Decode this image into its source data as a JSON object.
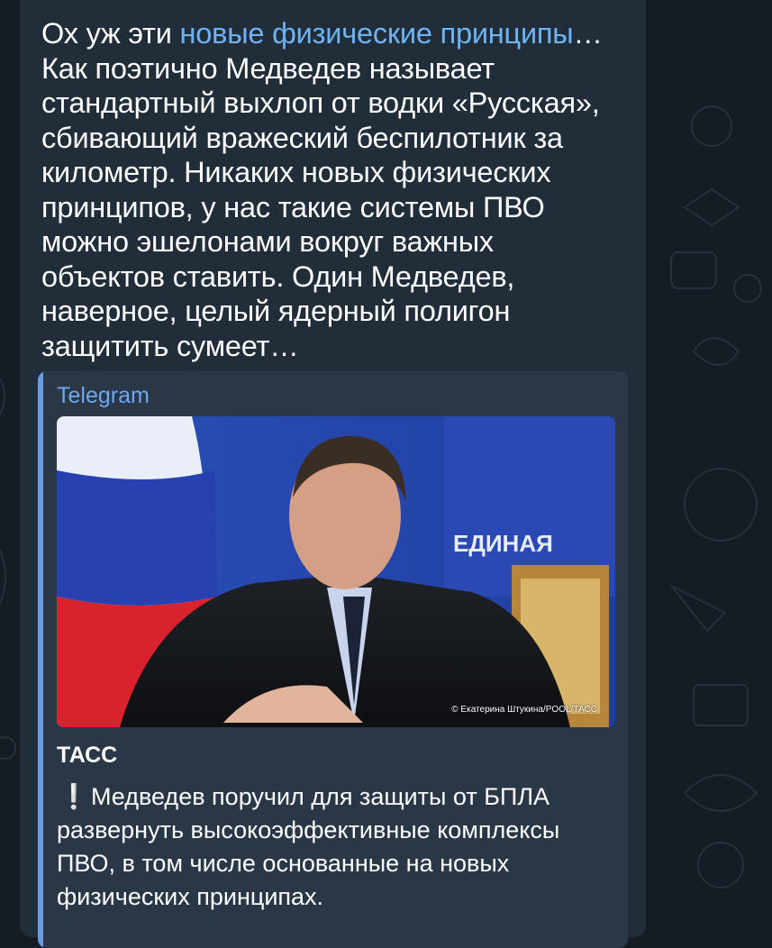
{
  "message": {
    "text_before_link": "Ох уж эти ",
    "link_text": "новые физические принципы",
    "text_after_link": "… Как поэтично Медведев называет стандартный выхлоп от водки «Русская», сбивающий вражеский беспилотник за километр. Никаких новых физических принципов, у нас такие системы ПВО можно эшелонами вокруг важных объектов ставить. Один Медведев, наверное, целый ядерный полигон защитить сумеет…"
  },
  "link_preview": {
    "site_name": "Telegram",
    "photo_credit": "© Екатерина Штукина/POOL/ТАСС",
    "title": "ТАСС",
    "description_icon": "exclamation-icon",
    "description": "Медведев поручил для защиты от БПЛА развернуть высокоэффективные комплексы ПВО, в том числе основанные на новых физических принципах."
  },
  "colors": {
    "background": "#151c24",
    "bubble": "#222d3a",
    "preview": "#2a3747",
    "accent_bar": "#6a9be0",
    "link": "#6eb4f5"
  }
}
